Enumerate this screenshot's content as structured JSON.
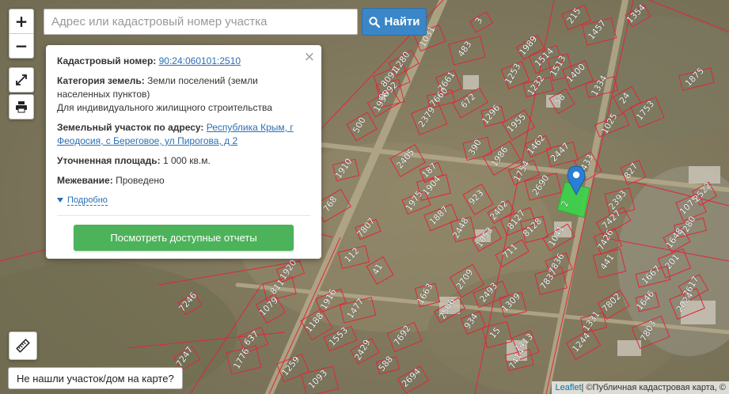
{
  "search": {
    "placeholder": "Адрес или кадастровый номер участка",
    "button_label": "Найти"
  },
  "controls": {
    "zoom_in": "+",
    "zoom_out": "−"
  },
  "popup": {
    "cadastral_label": "Кадастровый номер:",
    "cadastral_value": "90:24:060101:2510",
    "category_label": "Категория земель:",
    "category_value": "Земли поселений (земли населенных пунктов)",
    "category_purpose": "Для индивидуального жилищного строительства",
    "address_label": "Земельный участок по адресу:",
    "address_value": "Республика Крым, г Феодосия, с Береговое, ул Пирогова, д 2",
    "area_label": "Уточненная площадь:",
    "area_value": "1 000 кв.м.",
    "survey_label": "Межевание:",
    "survey_value": "Проведено",
    "more_label": "Подробно",
    "reports_button": "Посмотреть доступные отчеты",
    "close": "×"
  },
  "not_found_button": "Не нашли участок/дом на карте?",
  "attribution": {
    "leaflet": "Leaflet",
    "separator": " | © ",
    "source": "Публичная кадастровая карта, ©"
  },
  "map": {
    "selected_plot_color": "#3fd14a",
    "marker_color": "#2a7fd4",
    "parcel_line_color": "#e0263a",
    "plot_labels": [
      "3",
      "215",
      "1457",
      "1354",
      "1031",
      "483",
      "1989",
      "1514",
      "1513",
      "1280",
      "8091",
      "8092",
      "1956",
      "7661",
      "7660",
      "672",
      "1253",
      "1232",
      "58",
      "1400",
      "1334",
      "24",
      "1753",
      "1875",
      "500",
      "2379",
      "1296",
      "1955",
      "1025",
      "1910",
      "2405",
      "187",
      "390",
      "1986",
      "1462",
      "2447",
      "2433",
      "1975",
      "1904",
      "923",
      "1754",
      "2690",
      "2402",
      "1887",
      "2448",
      "1053",
      "8127",
      "8128",
      "1041",
      "827",
      "2393",
      "7427",
      "7426",
      "441",
      "2522",
      "1075",
      "7280",
      "1648",
      "201",
      "1667",
      "7617",
      "2024",
      "1646",
      "7802",
      "7803",
      "1331",
      "1244",
      "7413",
      "7414",
      "768",
      "7807",
      "112",
      "41",
      "1920",
      "811",
      "1079",
      "1916",
      "1477",
      "1188",
      "1553",
      "1663",
      "2709",
      "2493",
      "1309",
      "2506",
      "934",
      "15",
      "711",
      "7836",
      "7837",
      "7246",
      "637",
      "1776",
      "7247",
      "1259",
      "1093",
      "2429",
      "7692",
      "588",
      "2694"
    ]
  }
}
